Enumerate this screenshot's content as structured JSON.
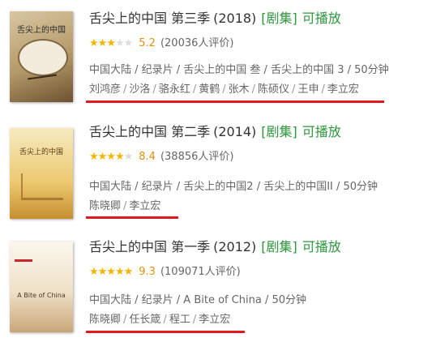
{
  "results": [
    {
      "title": "舌尖上的中国 第三季",
      "year": "(2018)",
      "tag_series": "[剧集]",
      "tag_play": "可播放",
      "stars_full": 2,
      "stars_half": 1,
      "score": "5.2",
      "votes": "(20036人评价)",
      "meta": "中国大陆 / 纪录片 / 舌尖上的中国 叁 / 舌尖上的中国 3 / 50分钟",
      "people": [
        "刘鸿彦",
        "沙洛",
        "骆永红",
        "黄鹤",
        "张木",
        "陈硕仪",
        "王申",
        "李立宏"
      ],
      "poster_text": "舌尖上的中国",
      "poster_colors": [
        "#c9b58d",
        "#5c4628"
      ]
    },
    {
      "title": "舌尖上的中国 第二季",
      "year": "(2014)",
      "tag_series": "[剧集]",
      "tag_play": "可播放",
      "stars_full": 4,
      "stars_half": 0,
      "score": "8.4",
      "votes": "(38856人评价)",
      "meta": "中国大陆 / 纪录片 / 舌尖上的中国2 / 舌尖上的中国II / 50分钟",
      "people": [
        "陈晓卿",
        "李立宏"
      ],
      "poster_text": "舌尖上的中国",
      "poster_colors": [
        "#f2e2a6",
        "#d9a94a"
      ]
    },
    {
      "title": "舌尖上的中国 第一季",
      "year": "(2012)",
      "tag_series": "[剧集]",
      "tag_play": "可播放",
      "stars_full": 4,
      "stars_half": 1,
      "score": "9.3",
      "votes": "(109071人评价)",
      "meta": "中国大陆 / 纪录片 / A Bite of China / 50分钟",
      "people": [
        "陈晓卿",
        "任长箴",
        "程工",
        "李立宏"
      ],
      "poster_text": "A Bite of China",
      "poster_colors": [
        "#f7f1e6",
        "#c4a27a"
      ]
    }
  ],
  "colors": {
    "accent_green": "#2e963d",
    "underline_red": "#e0191c",
    "star": "#f4b400",
    "score": "#e09015"
  }
}
